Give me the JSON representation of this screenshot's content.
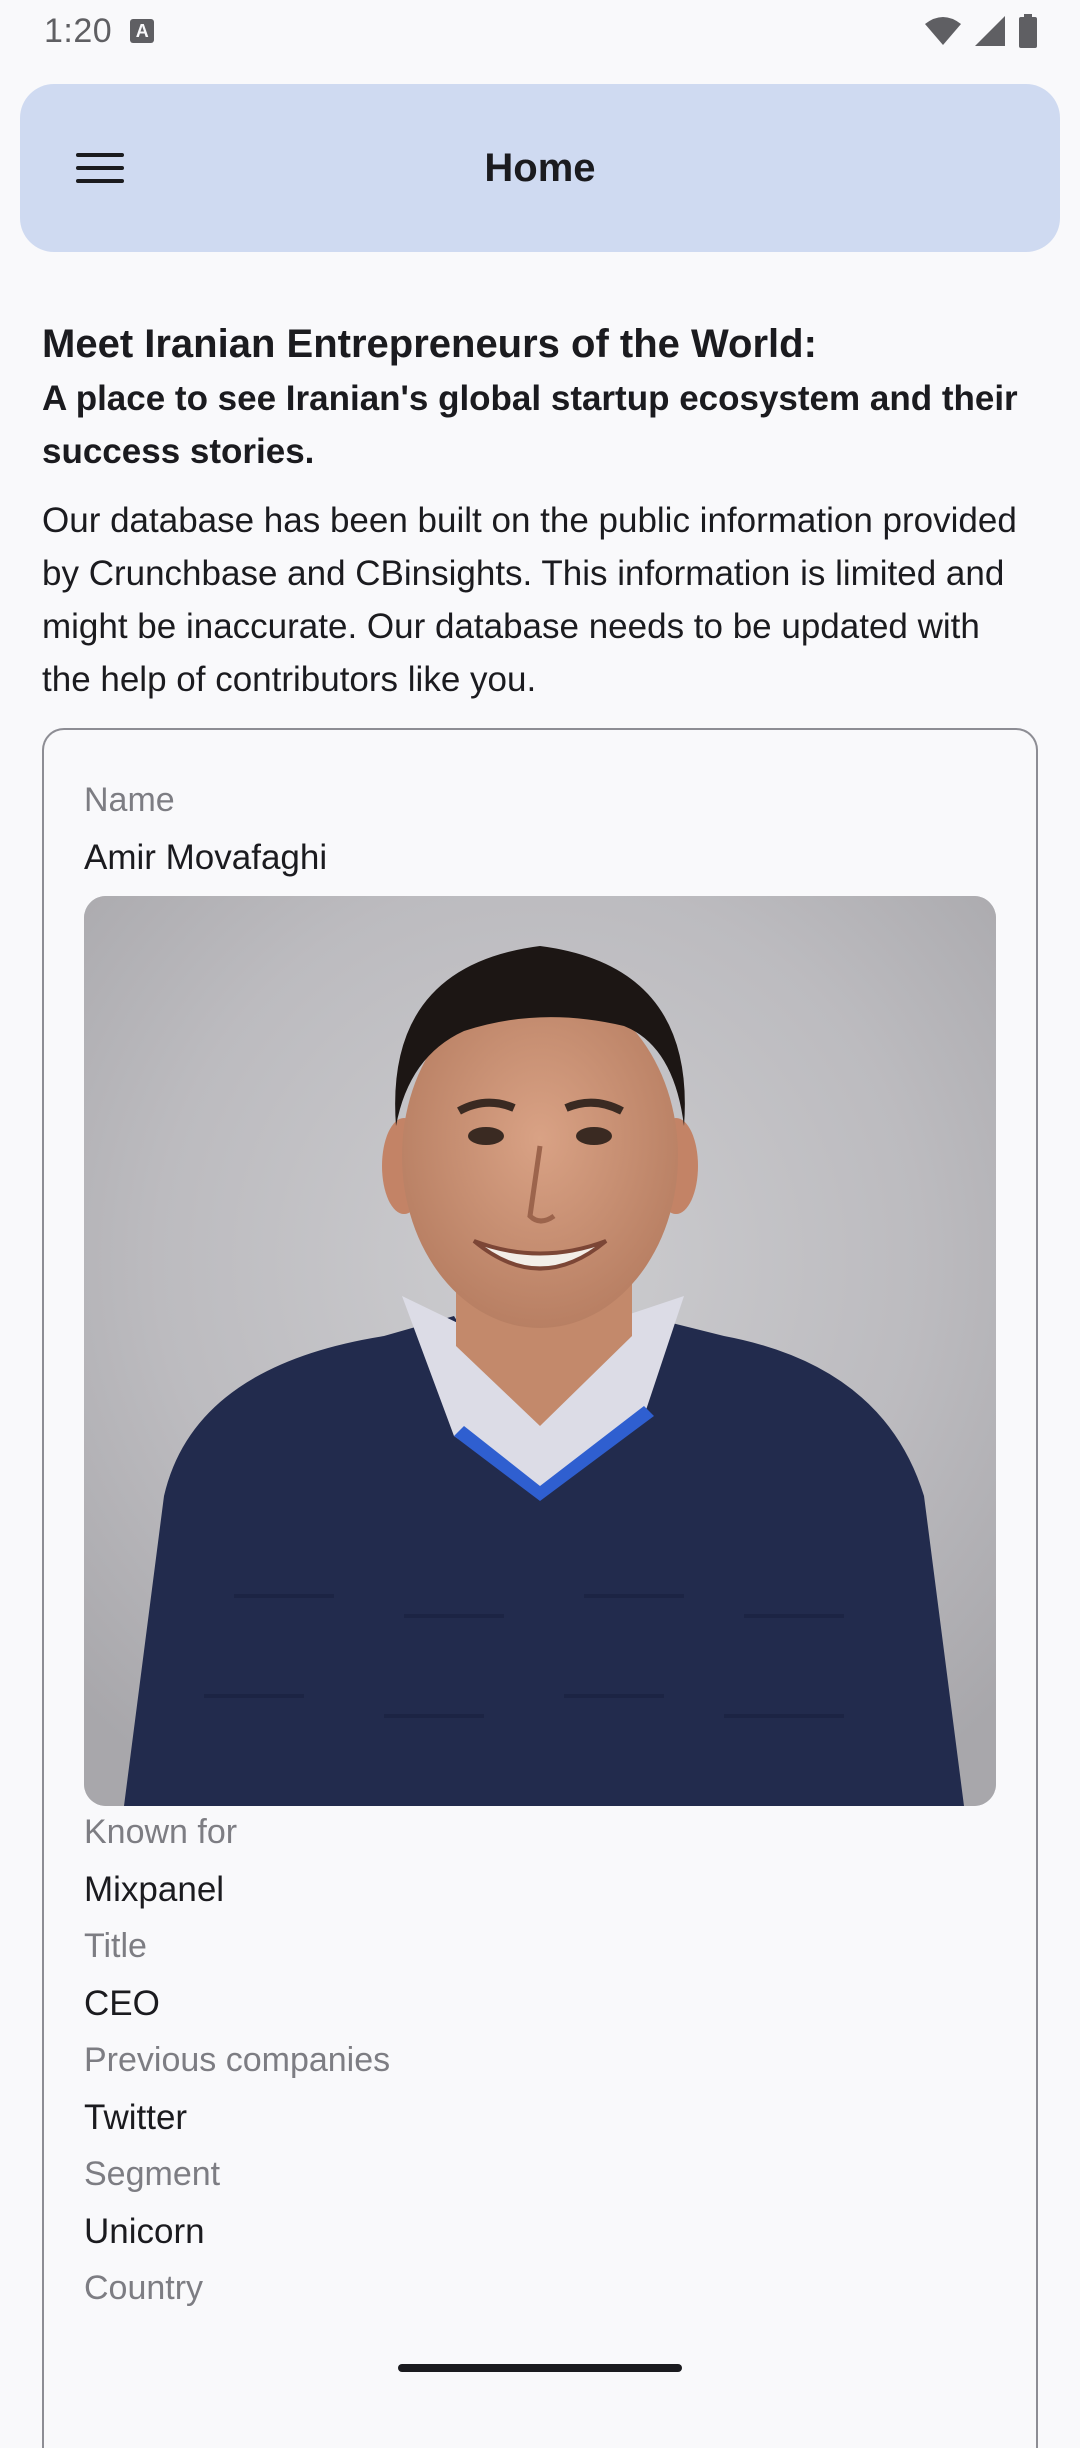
{
  "status_bar": {
    "time": "1:20",
    "notification_badge": "A",
    "icons": [
      "wifi-icon",
      "cellular-signal-icon",
      "battery-icon"
    ]
  },
  "app_bar": {
    "title": "Home",
    "menu_icon": "hamburger-menu-icon",
    "background": "#cfdaf1"
  },
  "intro": {
    "headline": "Meet Iranian Entrepreneurs of the World:",
    "subheadline": "A place to see Iranian's global startup ecosystem and their success stories.",
    "body": "Our database has been built on the public information provided by Crunchbase and CBinsights. This information is limited and might be inaccurate. Our database needs to be updated with the help of contributors like you."
  },
  "profile": {
    "name_label": "Name",
    "name": "Amir Movafaghi",
    "known_for_label": "Known for",
    "known_for": "Mixpanel",
    "title_label": "Title",
    "title": "CEO",
    "previous_companies_label": "Previous companies",
    "previous_companies": "Twitter",
    "segment_label": "Segment",
    "segment": "Unicorn",
    "country_label": "Country"
  }
}
